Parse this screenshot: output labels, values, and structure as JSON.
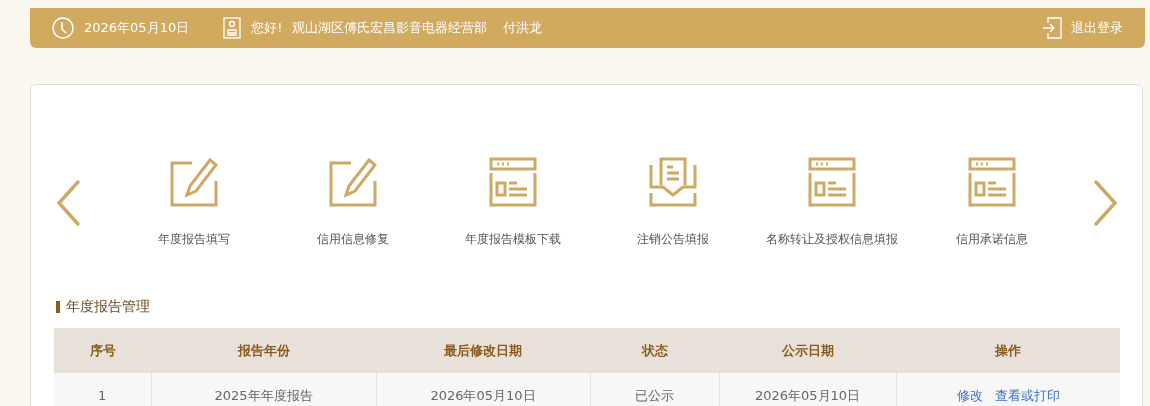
{
  "header": {
    "date": "2026年05月10日",
    "greeting": "您好!",
    "company": "观山湖区傅氏宏昌影音电器经营部",
    "user": "付洪龙",
    "logout": "退出登录"
  },
  "menu": [
    {
      "kind": "edit",
      "label": "年度报告填写"
    },
    {
      "kind": "edit",
      "label": "信用信息修复"
    },
    {
      "kind": "form",
      "label": "年度报告模板下载"
    },
    {
      "kind": "tray",
      "label": "注销公告填报"
    },
    {
      "kind": "form",
      "label": "名称转让及授权信息填报"
    },
    {
      "kind": "form",
      "label": "信用承诺信息"
    }
  ],
  "section_title": "年度报告管理",
  "table": {
    "columns": [
      "序号",
      "报告年份",
      "最后修改日期",
      "状态",
      "公示日期",
      "操作"
    ],
    "rows": [
      {
        "cells": [
          "1",
          "2025年年度报告",
          "2026年05月10日",
          "已公示",
          "2026年05月10日"
        ],
        "actions": [
          "修改",
          "查看或打印"
        ]
      }
    ]
  }
}
